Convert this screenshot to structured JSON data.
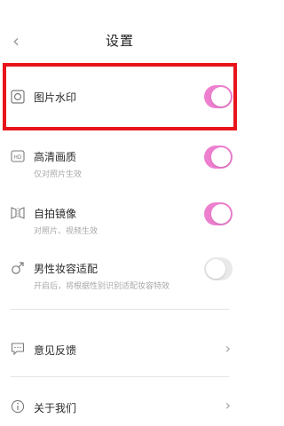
{
  "header": {
    "back_icon": "chevron-left-icon",
    "title": "设置"
  },
  "settings": [
    {
      "icon": "circle-outline-icon",
      "label": "图片水印",
      "sub": "",
      "on": true
    },
    {
      "icon": "hd-icon",
      "label": "高清画质",
      "sub": "仅对照片生效",
      "on": true
    },
    {
      "icon": "mirror-icon",
      "label": "自拍镜像",
      "sub": "对照片、视频生效",
      "on": true
    },
    {
      "icon": "male-icon",
      "label": "男性妆容适配",
      "sub": "开启后，将根据性别识别适配妆容特效",
      "on": false
    }
  ],
  "links": [
    {
      "icon": "chat-icon",
      "label": "意见反馈",
      "chevron": "chevron-right-icon"
    },
    {
      "icon": "info-icon",
      "label": "关于我们",
      "chevron": "chevron-right-icon"
    }
  ],
  "colors": {
    "toggle_on": "#ee7fcf",
    "toggle_off": "#e9e9e9",
    "highlight": "#e8141a"
  }
}
